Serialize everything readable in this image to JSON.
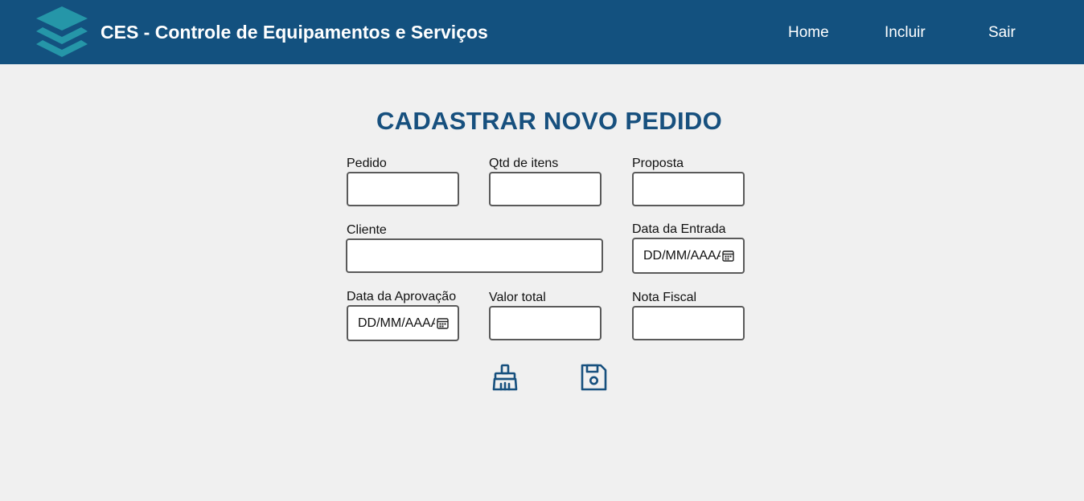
{
  "header": {
    "app_title": "CES - Controle de Equipamentos e Serviços",
    "nav": {
      "home": "Home",
      "incluir": "Incluir",
      "sair": "Sair"
    },
    "logo_icon": "layers-icon"
  },
  "page": {
    "title": "CADASTRAR NOVO PEDIDO"
  },
  "form": {
    "pedido": {
      "label": "Pedido",
      "value": ""
    },
    "qtd_itens": {
      "label": "Qtd de itens",
      "value": ""
    },
    "proposta": {
      "label": "Proposta",
      "value": ""
    },
    "cliente": {
      "label": "Cliente",
      "value": ""
    },
    "data_entrada": {
      "label": "Data da Entrada",
      "placeholder": "DD/MM/AAAA"
    },
    "data_aprovacao": {
      "label": "Data da Aprovação",
      "placeholder": "DD/MM/AAAA"
    },
    "valor_total": {
      "label": "Valor total",
      "value": ""
    },
    "nota_fiscal": {
      "label": "Nota Fiscal",
      "value": ""
    }
  },
  "actions": {
    "clear_icon": "broom-icon",
    "save_icon": "floppy-disk-icon"
  },
  "colors": {
    "header_bg": "#13517f",
    "title": "#17507e",
    "background": "#f0f0f0",
    "logo": "#2596a8"
  }
}
